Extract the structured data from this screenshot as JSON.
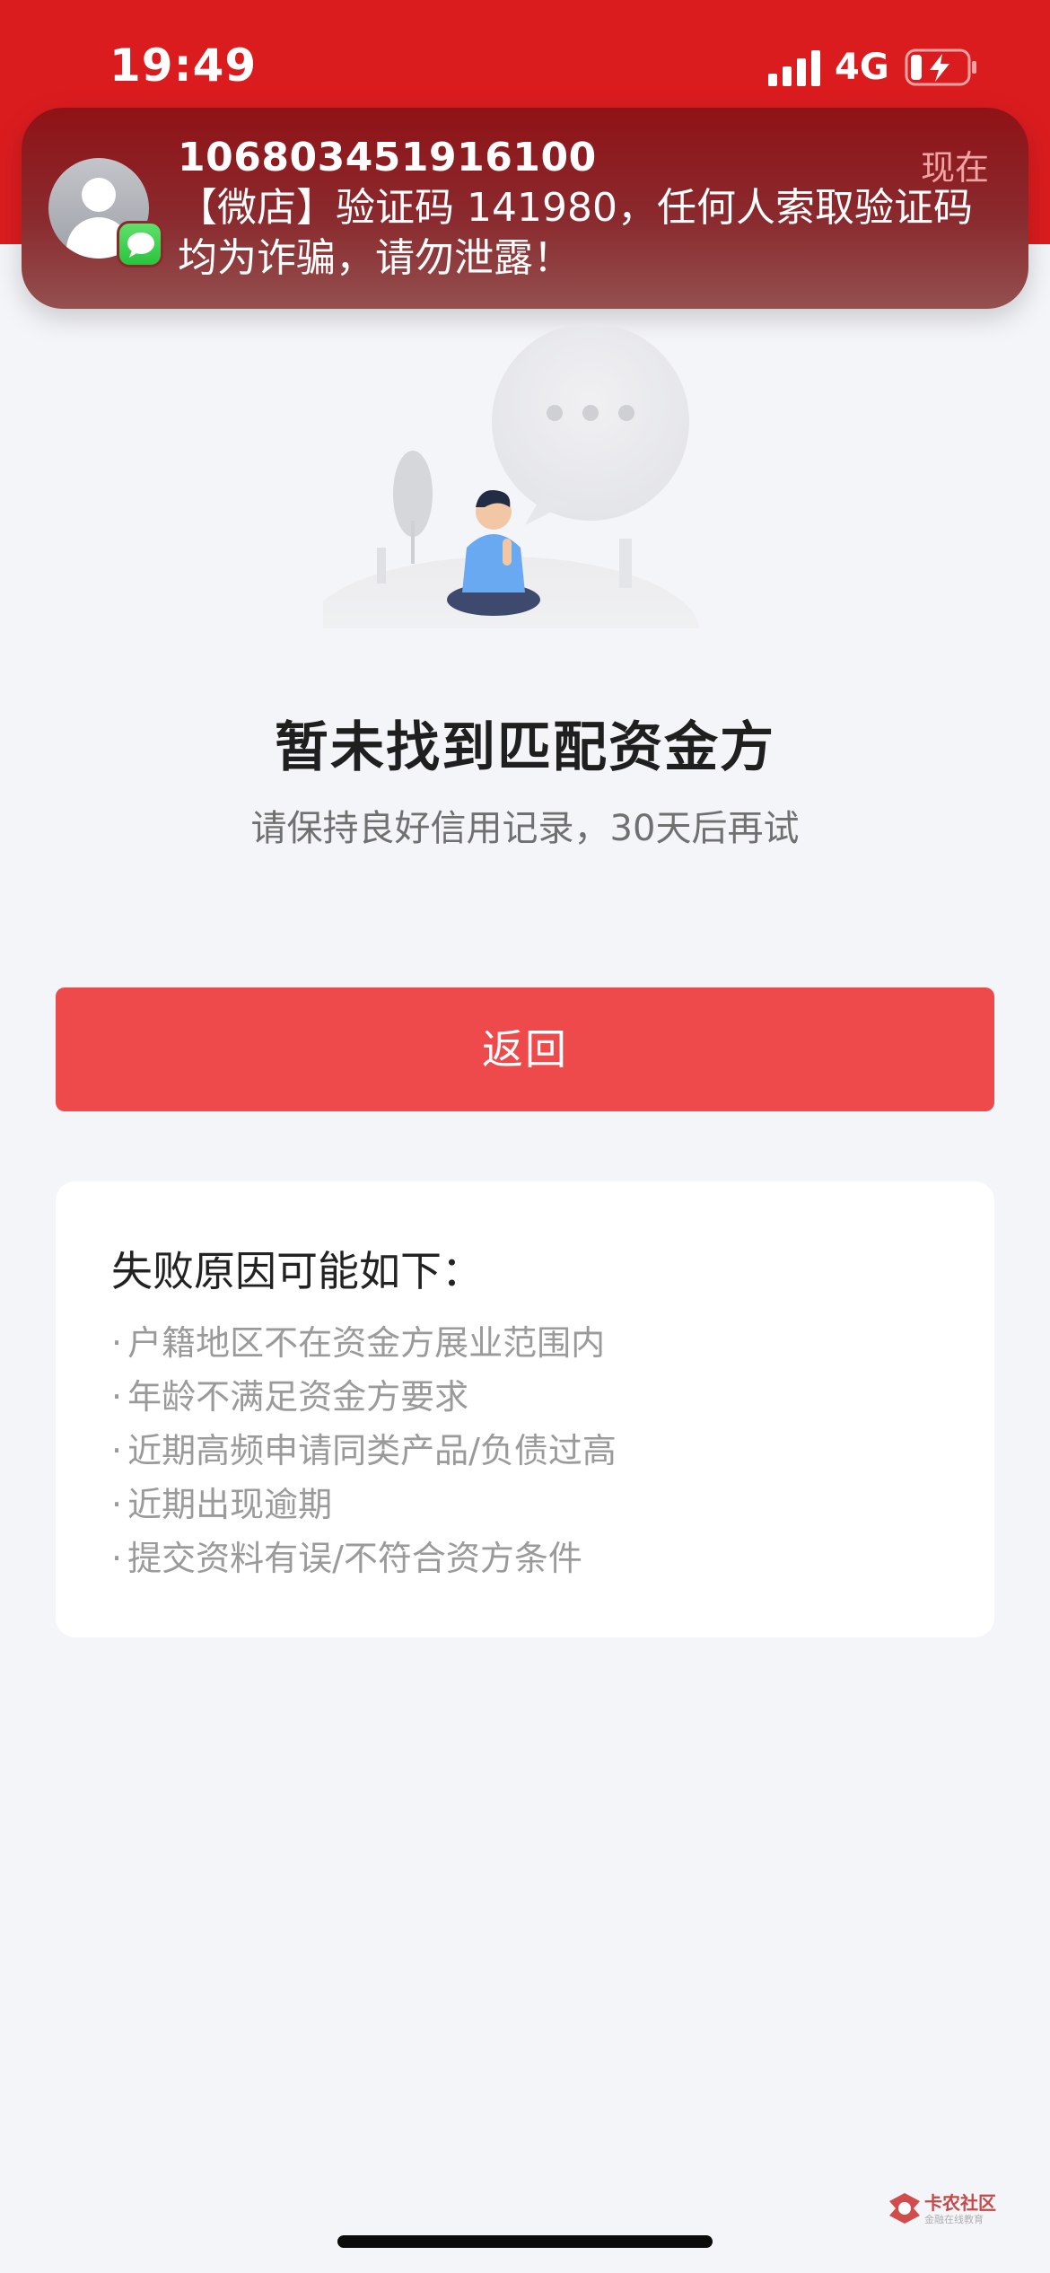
{
  "status_bar": {
    "time": "19:49",
    "network": "4G"
  },
  "notification": {
    "sender": "106803451916100",
    "time": "现在",
    "body": "【微店】验证码 141980，任何人索取验证码均为诈骗，请勿泄露！"
  },
  "result": {
    "title": "暂未找到匹配资金方",
    "subtitle": "请保持良好信用记录，30天后再试"
  },
  "actions": {
    "back_label": "返回"
  },
  "reasons": {
    "title": "失败原因可能如下：",
    "items": [
      "户籍地区不在资金方展业范围内",
      "年龄不满足资金方要求",
      "近期高频申请同类产品/负债过高",
      "近期出现逾期",
      "提交资料有误/不符合资方条件"
    ]
  },
  "watermark": {
    "text": "卡农社区",
    "sub": "金融在线教育"
  },
  "colors": {
    "header_red": "#db1c1f",
    "button_red": "#ef4a4b",
    "background": "#f4f5f9"
  },
  "icons": [
    "cellular-signal-icon",
    "battery-charging-icon",
    "contact-avatar-icon",
    "messages-app-icon"
  ]
}
